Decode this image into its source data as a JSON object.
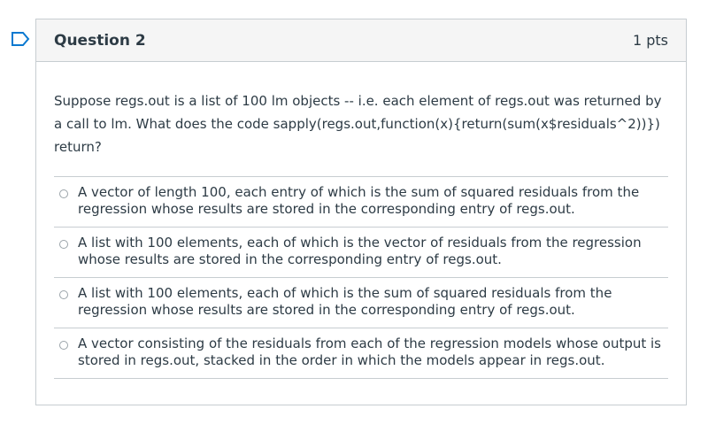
{
  "question": {
    "title": "Question 2",
    "points": "1 pts",
    "text": "Suppose regs.out is a list of 100 lm objects -- i.e. each element of regs.out was returned by a call to lm. What does the code sapply(regs.out,function(x){return(sum(x$residuals^2))}) return?"
  },
  "answers": [
    {
      "label": "A vector of length 100, each entry of which is the sum of squared residuals from the regression whose results are stored in the corresponding entry of regs.out."
    },
    {
      "label": "A list with 100 elements, each of which is the vector of residuals from the regression whose results are stored in the corresponding entry of regs.out."
    },
    {
      "label": "A list with 100 elements, each of which is the sum of squared residuals from the regression whose results are stored in the corresponding entry of regs.out."
    },
    {
      "label": "A vector consisting of the residuals from each of the regression models whose output is stored in regs.out, stacked in the order in which the models appear in regs.out."
    }
  ],
  "colors": {
    "accent": "#0b79d0",
    "border": "#c7cdd1",
    "text": "#2d3b45"
  },
  "icons": {
    "flag": "flag-outline-icon"
  }
}
